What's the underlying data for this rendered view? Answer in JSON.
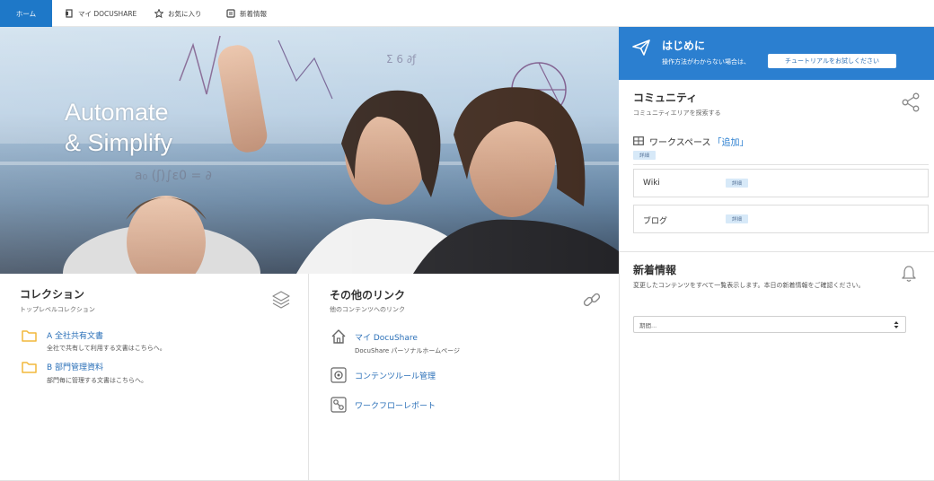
{
  "nav": {
    "items": [
      {
        "label": "ホーム",
        "icon": "none",
        "active": true
      },
      {
        "label": "マイ DOCUSHARE",
        "icon": "document-icon",
        "active": false
      },
      {
        "label": "お気に入り",
        "icon": "star-icon",
        "active": false
      },
      {
        "label": "新着情報",
        "icon": "news-icon",
        "active": false
      }
    ]
  },
  "hero": {
    "title_line1": "Automate",
    "title_line2": "& Simplify",
    "slide_count": 5,
    "active_slide": 2
  },
  "start": {
    "title": "はじめに",
    "description": "操作方法がわからない場合は、",
    "button": "チュートリアルをお試しください"
  },
  "community": {
    "title": "コミュニティ",
    "subtitle": "コミュニティエリアを探索する",
    "workspace_label": "ワークスペース",
    "workspace_add": "「追加」",
    "detail_badge": "詳細",
    "items": [
      {
        "label": "Wiki",
        "badge": "詳細"
      },
      {
        "label": "ブログ",
        "badge": "詳細"
      }
    ]
  },
  "news": {
    "title": "新着情報",
    "description": "変更したコンテンツをすべて一覧表示します。本日の新着情報をご確認ください。",
    "select_value": "期間..."
  },
  "collections": {
    "title": "コレクション",
    "subtitle": "トップレベルコレクション",
    "items": [
      {
        "label": "A 全社共有文書",
        "desc": "全社で共有して利用する文書はこちらへ。"
      },
      {
        "label": "B 部門管理資料",
        "desc": "部門毎に管理する文書はこちらへ。"
      }
    ]
  },
  "links": {
    "title": "その他のリンク",
    "subtitle": "他のコンテンツへのリンク",
    "items": [
      {
        "label": "マイ DocuShare",
        "desc": "DocuShare パーソナルホームページ",
        "icon": "home-icon"
      },
      {
        "label": "コンテンツルール管理",
        "desc": "",
        "icon": "gear-icon"
      },
      {
        "label": "ワークフローレポート",
        "desc": "",
        "icon": "workflow-icon"
      }
    ]
  },
  "colors": {
    "accent": "#1e78c8",
    "banner": "#2b7fd0",
    "link": "#2b70b8",
    "folder": "#f2b83c",
    "badge_bg": "#d7e9f8"
  }
}
